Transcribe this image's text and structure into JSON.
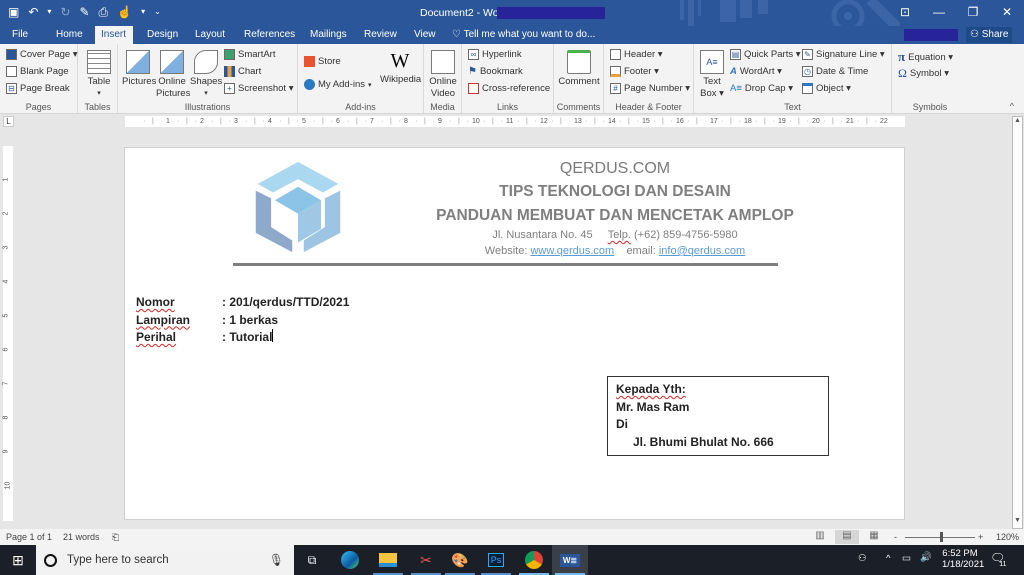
{
  "window": {
    "title": "Document2 - Word",
    "controls": {
      "ribbon_display": "⊡",
      "minimize": "—",
      "restore": "❐",
      "close": "✕"
    }
  },
  "quick_access": {
    "save": "💾",
    "undo": "↶",
    "undo_dropdown": "▾",
    "redo": "↷",
    "touch_mode": "✎",
    "print_preview": "⎙",
    "touch": "☝",
    "more": "▾",
    "customize": "⌄"
  },
  "tabs": [
    {
      "label": "File"
    },
    {
      "label": "Home"
    },
    {
      "label": "Insert",
      "active": true
    },
    {
      "label": "Design"
    },
    {
      "label": "Layout"
    },
    {
      "label": "References"
    },
    {
      "label": "Mailings"
    },
    {
      "label": "Review"
    },
    {
      "label": "View"
    }
  ],
  "tell_me": {
    "icon": "lightbulb-icon",
    "placeholder": "Tell me what you want to do..."
  },
  "share_label": "Share",
  "ribbon": {
    "pages": {
      "label": "Pages",
      "cover_page": "Cover Page ▾",
      "blank_page": "Blank Page",
      "page_break": "Page Break"
    },
    "tables": {
      "label": "Tables",
      "table": "Table",
      "arrow": "▾"
    },
    "illustrations": {
      "label": "Illustrations",
      "pictures": "Pictures",
      "online_pictures_1": "Online",
      "online_pictures_2": "Pictures",
      "shapes": "Shapes",
      "shapes_arrow": "▾",
      "smartart": "SmartArt",
      "chart": "Chart",
      "screenshot": "Screenshot ▾"
    },
    "addins": {
      "label": "Add-ins",
      "store": "Store",
      "my_addins": "My Add-ins",
      "my_addins_arrow": "▾",
      "wikipedia": "Wikipedia",
      "wiki_glyph": "W"
    },
    "media": {
      "label": "Media",
      "online_video_1": "Online",
      "online_video_2": "Video"
    },
    "links": {
      "label": "Links",
      "hyperlink": "Hyperlink",
      "bookmark": "Bookmark",
      "cross_reference": "Cross-reference"
    },
    "comments": {
      "label": "Comments",
      "comment": "Comment"
    },
    "header_footer": {
      "label": "Header & Footer",
      "header": "Header ▾",
      "footer": "Footer ▾",
      "page_number": "Page Number ▾"
    },
    "text": {
      "label": "Text",
      "text_box_1": "Text",
      "text_box_2": "Box ▾",
      "quick_parts": "Quick Parts ▾",
      "wordart": "WordArt ▾",
      "drop_cap": "Drop Cap ▾",
      "signature_line": "Signature Line  ▾",
      "date_time": "Date & Time",
      "object": "Object  ▾"
    },
    "symbols": {
      "label": "Symbols",
      "equation": "Equation  ▾",
      "symbol": "Symbol ▾",
      "equation_glyph": "π",
      "symbol_glyph": "Ω"
    },
    "collapse": "^"
  },
  "ruler": {
    "tab_selector": "L",
    "h_marks": [
      "1",
      "2",
      "3",
      "4",
      "5",
      "6",
      "7",
      "8",
      "9",
      "10",
      "11",
      "12",
      "13",
      "14",
      "15",
      "16",
      "17",
      "18",
      "19",
      "20",
      "21",
      "22"
    ],
    "v_marks": [
      "1",
      "2",
      "3",
      "4",
      "5",
      "6",
      "7",
      "8",
      "9",
      "10"
    ]
  },
  "document": {
    "letterhead": {
      "site": "QERDUS.COM",
      "tagline": "TIPS TEKNOLOGI DAN DESAIN",
      "subtitle": "PANDUAN MEMBUAT DAN MENCETAK AMPLOP",
      "address": "Jl. Nusantara No. 45",
      "phone_label": "Telp.",
      "phone": "(+62) 859-4756-5980",
      "website_label": "Website:",
      "website": "www.qerdus.com",
      "email_label": "email:",
      "email": "info@qerdus.com"
    },
    "fields": [
      {
        "key": "Nomor",
        "value": ": 201/qerdus/TTD/2021"
      },
      {
        "key": "Lampiran",
        "value": ": 1 berkas"
      },
      {
        "key": "Perihal",
        "value": ": Tutorial"
      }
    ],
    "recipient": {
      "line1": "Kepada Yth:",
      "line2": "Mr. Mas Ram",
      "line3": "Di",
      "line4": "Jl. Bhumi Bhulat No. 666"
    }
  },
  "status_bar": {
    "page": "Page 1 of 1",
    "words": "21 words",
    "proofing_icon": "⎗",
    "zoom_minus": "-",
    "zoom_plus": "+",
    "zoom_level": "120%",
    "zoom_percent": 120
  },
  "taskbar": {
    "search_placeholder": "Type here to search",
    "time": "6:52 PM",
    "date": "1/18/2021",
    "notifications": "11",
    "apps": [
      "task-view",
      "edge",
      "file-explorer",
      "snipping-tool",
      "paint",
      "photoshop",
      "chrome",
      "word"
    ]
  }
}
